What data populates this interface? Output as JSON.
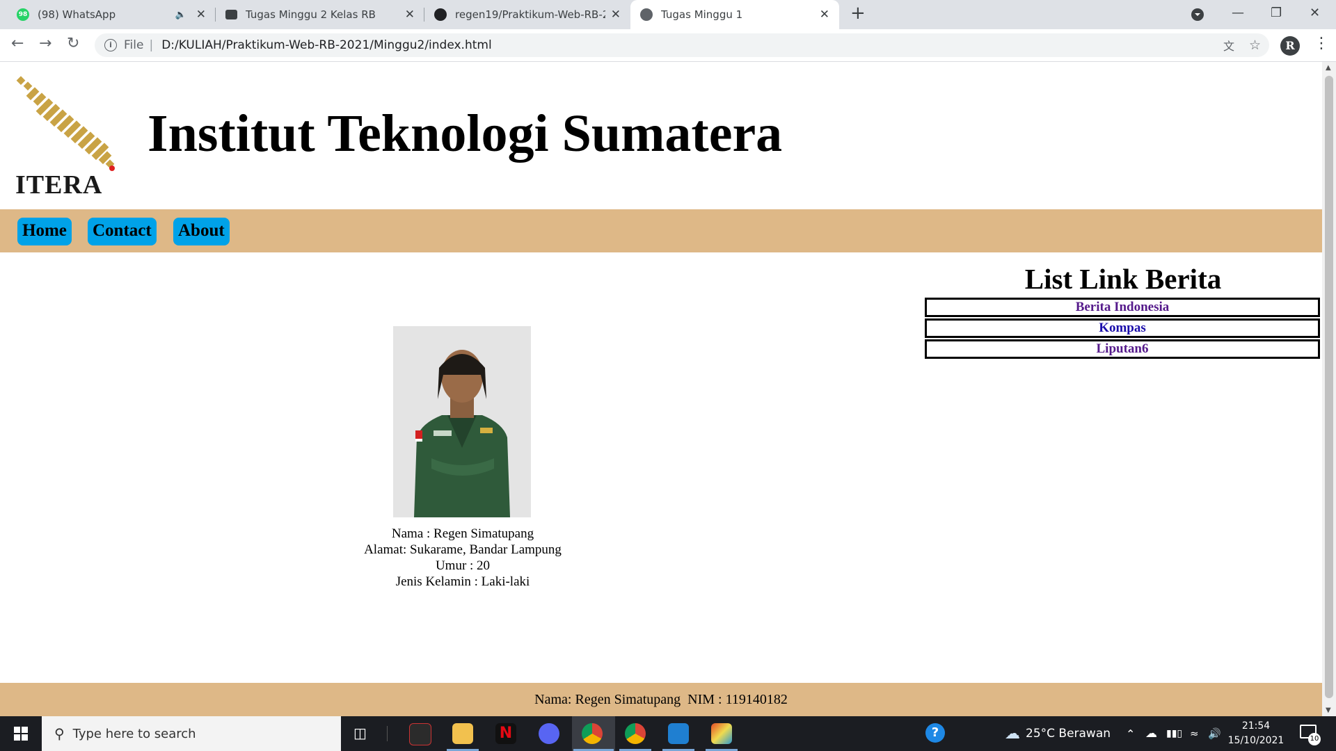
{
  "browser": {
    "tabs": [
      {
        "title": "(98) WhatsApp",
        "favicon": "whatsapp-icon",
        "audio": true
      },
      {
        "title": "Tugas Minggu 2 Kelas RB",
        "favicon": "classroom-icon"
      },
      {
        "title": "regen19/Praktikum-Web-RB-202",
        "favicon": "github-icon"
      },
      {
        "title": "Tugas Minggu 1",
        "favicon": "globe-icon",
        "active": true
      }
    ],
    "whatsapp_badge": "98",
    "address": {
      "scheme": "File",
      "url": "D:/KULIAH/Praktikum-Web-RB-2021/Minggu2/index.html"
    },
    "profile_initial": "R"
  },
  "page": {
    "logo_text": "ITERA",
    "title": "Institut Teknologi Sumatera",
    "nav": [
      "Home",
      "Contact",
      "About"
    ],
    "info": [
      "Nama : Regen Simatupang",
      "Alamat: Sukarame, Bandar Lampung",
      "Umur : 20",
      "Jenis Kelamin : Laki-laki"
    ],
    "aside": {
      "heading": "List Link Berita",
      "links": [
        "Berita Indonesia",
        "Kompas",
        "Liputan6"
      ]
    },
    "footer": "Nama: Regen Simatupang  NIM : 119140182"
  },
  "taskbar": {
    "search_placeholder": "Type here to search",
    "weather": "25°C  Berawan",
    "time": "21:54",
    "date": "15/10/2021",
    "notifications": "10"
  },
  "colors": {
    "nav_background": "#deb887",
    "nav_button": "#00a2e8",
    "footer_background": "#deb887",
    "logo_gold": "#c9a345"
  }
}
